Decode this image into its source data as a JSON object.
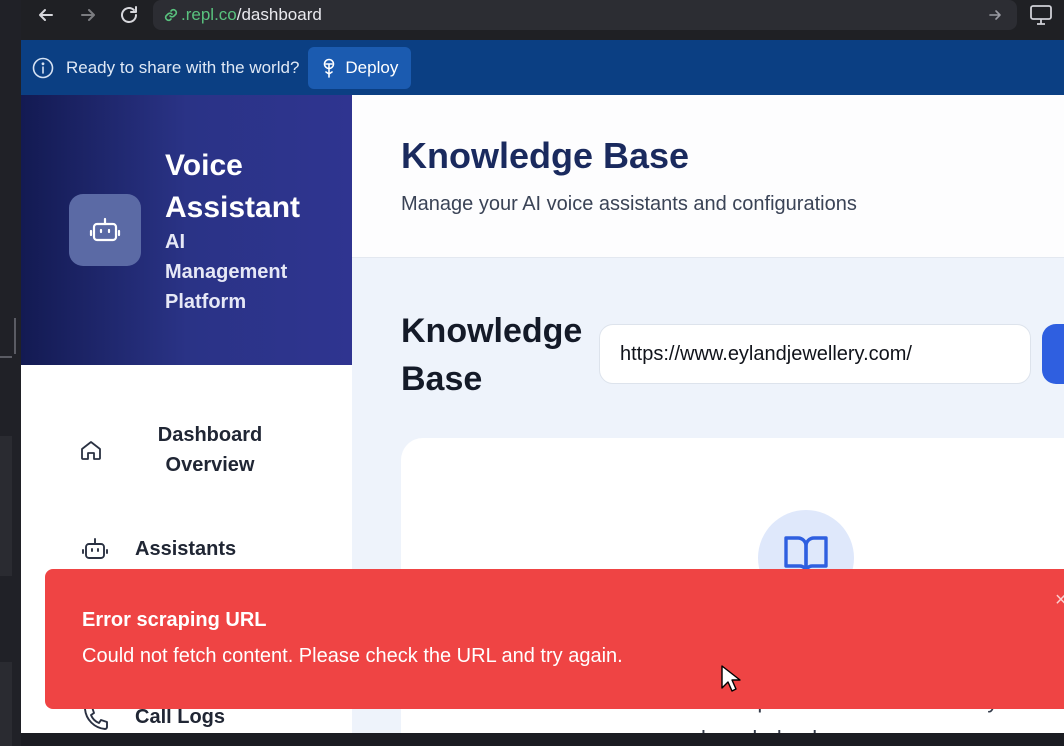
{
  "browser": {
    "url_host": ".repl.co",
    "url_path": "/dashboard"
  },
  "banner": {
    "message": "Ready to share with the world?",
    "deploy_label": "Deploy"
  },
  "brand": {
    "title_line1": "Voice",
    "title_line2": "Assistant",
    "subtitle_line1": "AI",
    "subtitle_line2": "Management",
    "subtitle_line3": "Platform"
  },
  "sidebar": {
    "items": [
      {
        "label_line1": "Dashboard",
        "label_line2": "Overview",
        "icon": "home-icon"
      },
      {
        "label": "Assistants",
        "icon": "bot-icon"
      },
      {
        "label": "Call Logs",
        "icon": "phone-icon"
      }
    ]
  },
  "main": {
    "title": "Knowledge Base",
    "subtitle": "Manage your AI voice assistants and configurations",
    "section_title_line1": "Knowledge",
    "section_title_line2": "Base",
    "url_input_value": "https://www.eylandjewellery.com/",
    "hint_line1": "Enter a URL above to scrape and store content in y",
    "hint_line2": "knowledge base"
  },
  "toast": {
    "title": "Error scraping URL",
    "description": "Could not fetch content. Please check the URL and try again.",
    "close": "×"
  },
  "colors": {
    "banner": "#0b3f83",
    "sidebar_brand": "#2a3386",
    "toast": "#ef4444",
    "accent": "#2f5fe0"
  }
}
